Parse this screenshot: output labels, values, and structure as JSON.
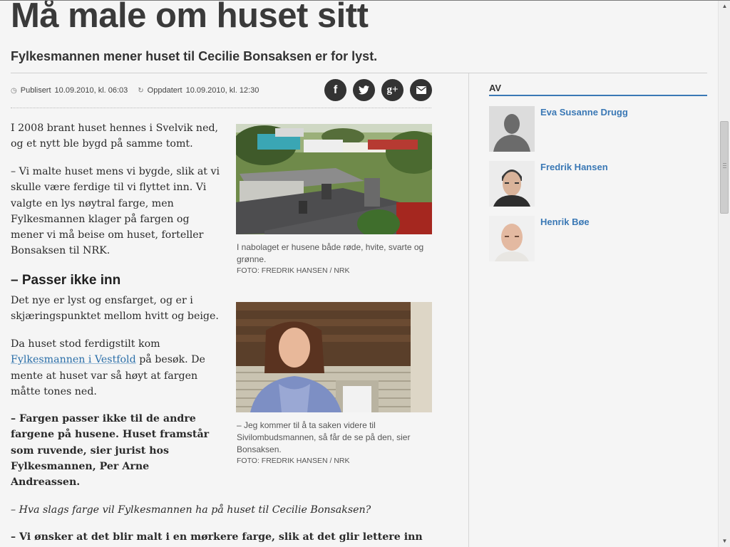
{
  "article": {
    "title": "Må male om huset sitt",
    "lead": "Fylkesmannen mener huset til Cecilie Bonsaksen er for lyst.",
    "meta": {
      "published_label": "Publisert",
      "published_value": "10.09.2010, kl. 06:03",
      "updated_label": "Oppdatert",
      "updated_value": "10.09.2010, kl. 12:30"
    },
    "share": [
      {
        "icon": "facebook-icon",
        "glyph": "f"
      },
      {
        "icon": "twitter-icon",
        "glyph": "🐦"
      },
      {
        "icon": "google-plus-icon",
        "glyph": "g+"
      },
      {
        "icon": "email-icon",
        "glyph": "✉"
      }
    ],
    "paragraphs": {
      "p1": "I 2008 brant huset hennes i Svelvik ned, og et nytt ble bygd på samme tomt.",
      "p2": "– Vi malte huset mens vi bygde, slik at vi skulle være ferdige til vi flyttet inn. Vi valgte en lys nøytral farge, men Fylkesmannen klager på fargen og mener vi må beise om huset, forteller Bonsaksen til NRK.",
      "subheading": "– Passer ikke inn",
      "p3": "Det nye er lyst og ensfarget, og er i skjæringspunktet mellom hvitt og beige.",
      "p4_before": "Da huset stod ferdigstilt kom ",
      "p4_link": "Fylkesmannen i Vestfold",
      "p4_after": " på besøk. De mente at huset var så høyt at fargen måtte tones ned.",
      "p5": "– Fargen passer ikke til de andre fargene på husene. Huset framstår som ruvende, sier jurist hos Fylkesmannen, Per Arne Andreassen.",
      "p6": "– Hva slags farge vil Fylkesmannen ha på huset til Cecilie Bonsaksen?",
      "p7": "– Vi ønsker at det blir malt i en mørkere farge, slik at det glir lettere inn"
    },
    "figures": [
      {
        "caption": "I nabolaget er husene både røde, hvite, svarte og grønne.",
        "credit": "FOTO: FREDRIK HANSEN / NRK"
      },
      {
        "caption": "– Jeg kommer til å ta saken videre til Sivilombudsmannen, så får de se på den, sier Bonsaksen.",
        "credit": "FOTO: FREDRIK HANSEN / NRK"
      }
    ]
  },
  "sidebar": {
    "heading": "AV",
    "authors": [
      {
        "name": "Eva Susanne Drugg"
      },
      {
        "name": "Fredrik Hansen"
      },
      {
        "name": "Henrik Bøe"
      }
    ]
  },
  "colors": {
    "accent": "#3a78b5",
    "share_bg": "#333333",
    "background": "#f5f5f5"
  }
}
